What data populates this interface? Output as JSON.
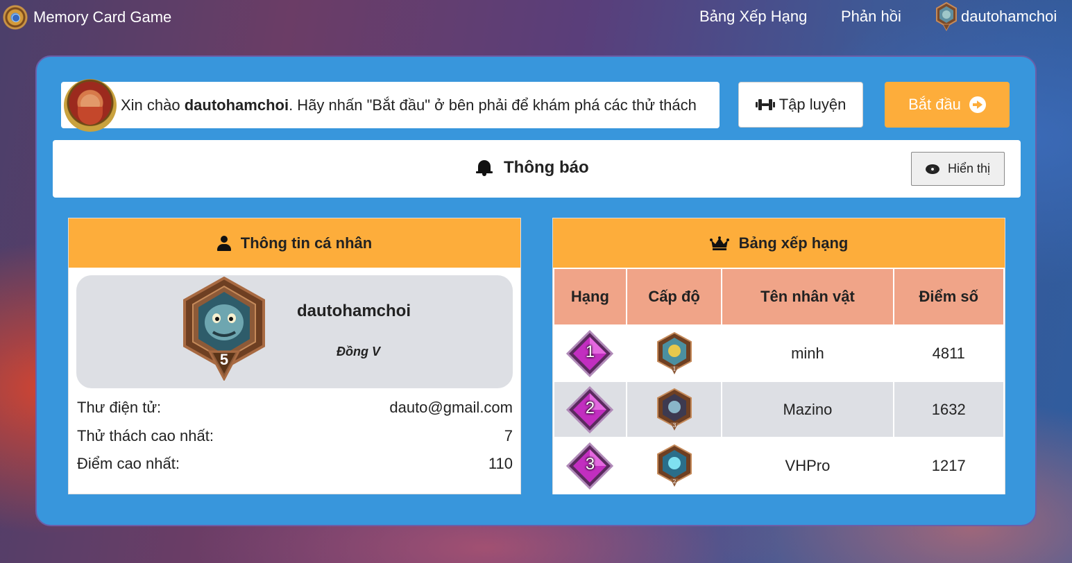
{
  "navbar": {
    "brand": "Memory Card Game",
    "links": {
      "rank": "Bảng Xếp Hạng",
      "feedback": "Phản hồi",
      "username": "dautohamchoi"
    }
  },
  "greeting": {
    "prefix": "Xin chào ",
    "username": "dautohamchoi",
    "suffix": ". Hãy nhấn \"Bắt đầu\" ở bên phải để khám phá các thử thách"
  },
  "buttons": {
    "practice": "Tập luyện",
    "start": "Bắt đầu",
    "show": "Hiển thị"
  },
  "notice": {
    "title": "Thông báo"
  },
  "profile": {
    "header": "Thông tin cá nhân",
    "name": "dautohamchoi",
    "badge_level": "5",
    "tier": "Đồng V",
    "rows": [
      {
        "label": "Thư điện tử:",
        "value": "dauto@gmail.com"
      },
      {
        "label": "Thử thách cao nhất:",
        "value": "7"
      },
      {
        "label": "Điểm cao nhất:",
        "value": "110"
      }
    ]
  },
  "leaderboard": {
    "header": "Bảng xếp hạng",
    "columns": [
      "Hạng",
      "Cấp độ",
      "Tên nhân vật",
      "Điểm số"
    ],
    "rows": [
      {
        "rank": "1",
        "level": "1",
        "name": "minh",
        "score": "4811"
      },
      {
        "rank": "2",
        "level": "3",
        "name": "Mazino",
        "score": "1632"
      },
      {
        "rank": "3",
        "level": "2",
        "name": "VHPro",
        "score": "1217"
      }
    ]
  },
  "colors": {
    "panel": "#3896dc",
    "accent": "#fdad3b",
    "table_header": "#f0a488",
    "row_alt": "#dddfe4"
  }
}
